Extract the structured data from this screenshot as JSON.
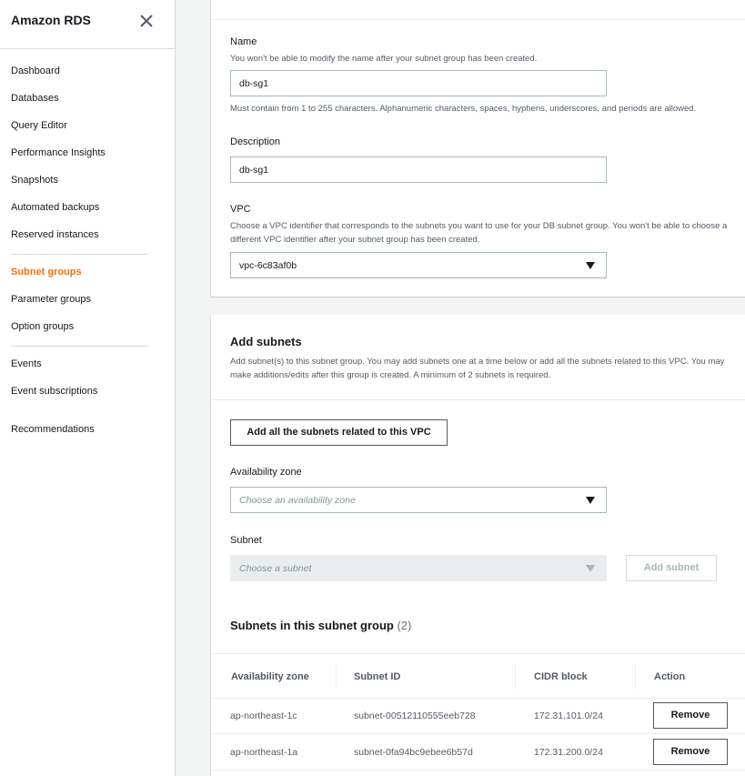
{
  "sidebar": {
    "title": "Amazon RDS",
    "items": [
      {
        "label": "Dashboard"
      },
      {
        "label": "Databases"
      },
      {
        "label": "Query Editor"
      },
      {
        "label": "Performance Insights"
      },
      {
        "label": "Snapshots"
      },
      {
        "label": "Automated backups"
      },
      {
        "label": "Reserved instances"
      },
      {
        "label": "Subnet groups",
        "active": true
      },
      {
        "label": "Parameter groups"
      },
      {
        "label": "Option groups"
      },
      {
        "label": "Events"
      },
      {
        "label": "Event subscriptions"
      },
      {
        "label": "Recommendations"
      }
    ]
  },
  "details": {
    "name_label": "Name",
    "name_hint": "You won't be able to modify the name after your subnet group has been created.",
    "name_value": "db-sg1",
    "name_constraint": "Must contain from 1 to 255 characters. Alphanumeric characters, spaces, hyphens, underscores, and periods are allowed.",
    "description_label": "Description",
    "description_value": "db-sg1",
    "vpc_label": "VPC",
    "vpc_hint": "Choose a VPC identifier that corresponds to the subnets you want to use for your DB subnet group. You won't be able to choose a different VPC identifier after your subnet group has been created.",
    "vpc_value": "vpc-6c83af0b"
  },
  "add_subnets": {
    "title": "Add subnets",
    "description": "Add subnet(s) to this subnet group. You may add subnets one at a time below or add all the subnets related to this VPC. You may make additions/edits after this group is created. A minimum of 2 subnets is required.",
    "add_all_button": "Add all the subnets related to this VPC",
    "az_label": "Availability zone",
    "az_placeholder": "Choose an availability zone",
    "subnet_label": "Subnet",
    "subnet_placeholder": "Choose a subnet",
    "add_subnet_button": "Add subnet"
  },
  "subnet_table": {
    "title": "Subnets in this subnet group",
    "count": "(2)",
    "columns": [
      "Availability zone",
      "Subnet ID",
      "CIDR block",
      "Action"
    ],
    "rows": [
      {
        "az": "ap-northeast-1c",
        "subnet_id": "subnet-00512110555eeb728",
        "cidr": "172.31.101.0/24",
        "action": "Remove"
      },
      {
        "az": "ap-northeast-1a",
        "subnet_id": "subnet-0fa94bc9ebee6b57d",
        "cidr": "172.31.200.0/24",
        "action": "Remove"
      }
    ]
  },
  "colors": {
    "accent": "#ec7211",
    "text": "#16191f",
    "muted": "#545b64",
    "border": "#d5dbdb"
  }
}
